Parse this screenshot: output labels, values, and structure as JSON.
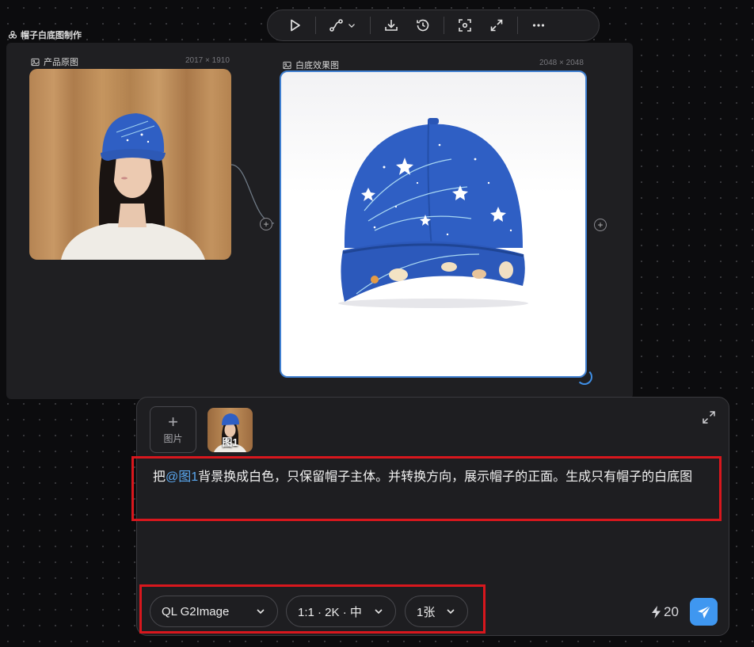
{
  "toolbar": {
    "items": [
      "play-icon",
      "connector-route-icon",
      "download-icon",
      "history-icon",
      "screenshot-icon",
      "expand-icon",
      "more-icon"
    ]
  },
  "group": {
    "title": "帽子白底图制作"
  },
  "nodes": [
    {
      "title": "产品原图",
      "size": "2017 × 1910"
    },
    {
      "title": "白底效果图",
      "size": "2048 × 2048"
    }
  ],
  "prompt_panel": {
    "add_image_label": "图片",
    "thumbnail_label": "图1",
    "prompt_prefix": "把",
    "prompt_mention": "@图1",
    "prompt_rest": "背景换成白色，只保留帽子主体。并转换方向，展示帽子的正面。生成只有帽子的白底图",
    "model": "QL G2Image",
    "ratio_quality": "1:1 · 2K · 中",
    "count": "1张",
    "credits": "20"
  },
  "colors": {
    "accent": "#3f97f0",
    "highlight": "#d8171d",
    "cap_blue": "#2f5fc4"
  }
}
